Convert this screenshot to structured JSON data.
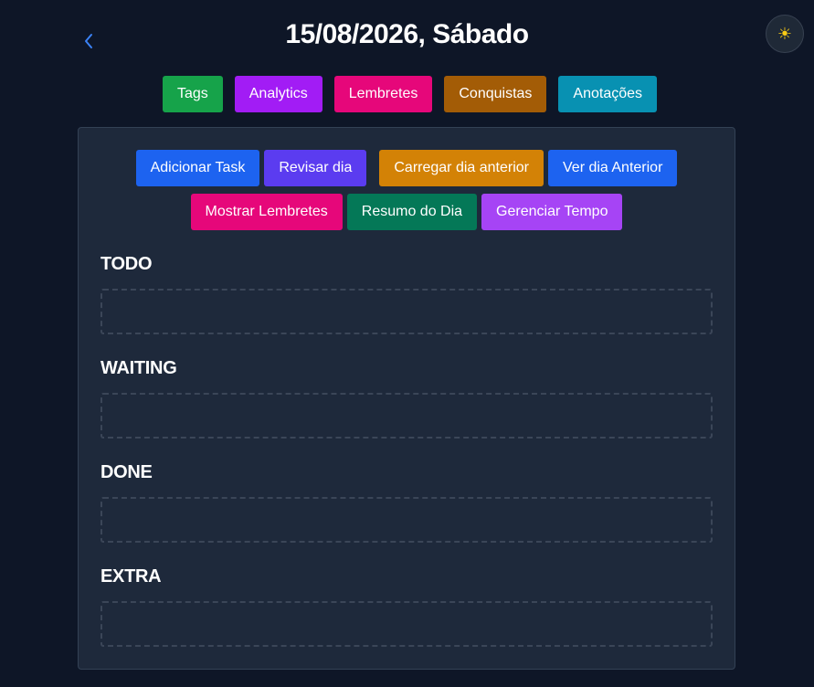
{
  "header": {
    "title": "15/08/2026, Sábado",
    "back_icon": "chevron-left-icon",
    "theme_icon": "sun-icon",
    "theme_glyph": "☀"
  },
  "nav": {
    "items": [
      {
        "label": "Tags",
        "color": "#16a34a"
      },
      {
        "label": "Analytics",
        "color": "#a21cf5"
      },
      {
        "label": "Lembretes",
        "color": "#e6077a"
      },
      {
        "label": "Conquistas",
        "color": "#a35c06"
      },
      {
        "label": "Anotações",
        "color": "#0891b2"
      }
    ]
  },
  "actions": {
    "row1": [
      {
        "label": "Adicionar Task",
        "color": "#1d63f0"
      },
      {
        "label": "Revisar dia",
        "color": "#5b3cf0"
      },
      {
        "label": "Carregar dia anterior",
        "color": "#d38206"
      },
      {
        "label": "Ver dia Anterior",
        "color": "#1d63f0"
      }
    ],
    "row2": [
      {
        "label": "Mostrar Lembretes",
        "color": "#e6077a"
      },
      {
        "label": "Resumo do Dia",
        "color": "#047857"
      },
      {
        "label": "Gerenciar Tempo",
        "color": "#a644f5"
      }
    ]
  },
  "sections": [
    {
      "title": "TODO"
    },
    {
      "title": "WAITING"
    },
    {
      "title": "DONE"
    },
    {
      "title": "EXTRA"
    }
  ],
  "colors": {
    "background": "#0e1627",
    "panel": "#1e293b",
    "accent_back": "#3b82f6"
  }
}
